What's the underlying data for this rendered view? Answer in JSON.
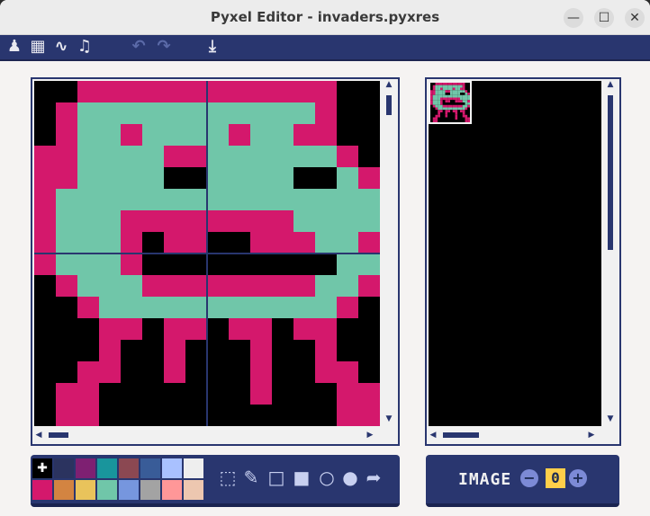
{
  "window": {
    "title": "Pyxel Editor - invaders.pyxres"
  },
  "window_controls": {
    "minimize": "—",
    "maximize": "☐",
    "close": "✕"
  },
  "toolbar": {
    "icons": [
      "sprite-editor-icon",
      "tilemap-editor-icon",
      "sound-editor-icon",
      "music-editor-icon",
      "undo-icon",
      "redo-icon",
      "save-icon"
    ]
  },
  "colors": {
    "pink": "#d4186c",
    "teal": "#70c6a9",
    "black": "#000000",
    "navy": "#29366f",
    "palette": [
      "#000000",
      "#2b335f",
      "#7e2072",
      "#19959c",
      "#8b4852",
      "#395c98",
      "#a9c1ff",
      "#eeeeee",
      "#d4186c",
      "#d38441",
      "#e9c35b",
      "#70c6a9",
      "#7696de",
      "#a3a3a3",
      "#ff9798",
      "#edc7b0"
    ]
  },
  "sprite": {
    "rows": [
      "..pppppppppppp..",
      ".ptttttttttttp..",
      ".pttpttttpttpp..",
      "ppttttppttttttp.",
      "pptttt..tttt..tp",
      "ptttttttttttttttp",
      "ptttppppppppttttp",
      "ptttp.pp..pppttp",
      "ptttp.........ttp",
      ".ptttppppppppttp.",
      "..ptttttttttttp..",
      "...pp.pp.pp.pp...",
      "...p..p...p..p...",
      "..pp..p...p..pp..",
      ".pp.......p...pp.",
      ".pp...........pp."
    ]
  },
  "image_selector": {
    "label": "IMAGE",
    "value": "0",
    "dec": "−",
    "inc": "+"
  },
  "palette_selected_index": 0
}
